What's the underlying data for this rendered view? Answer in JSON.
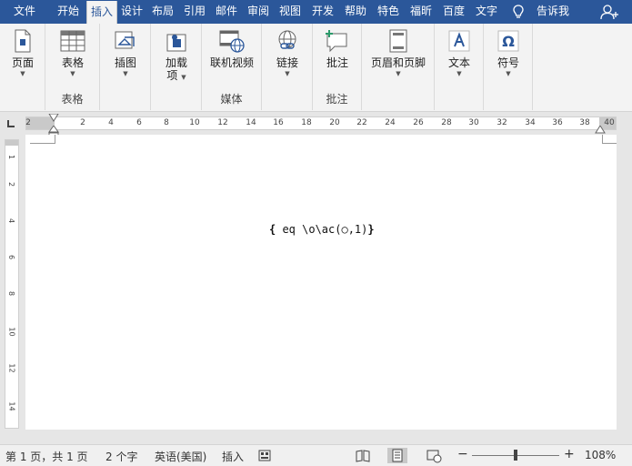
{
  "tabs": [
    {
      "label": "文件",
      "active": false
    },
    {
      "label": "开始",
      "active": false
    },
    {
      "label": "插入",
      "active": true
    },
    {
      "label": "设计",
      "active": false
    },
    {
      "label": "布局",
      "active": false
    },
    {
      "label": "引用",
      "active": false
    },
    {
      "label": "邮件",
      "active": false
    },
    {
      "label": "审阅",
      "active": false
    },
    {
      "label": "视图",
      "active": false
    },
    {
      "label": "开发",
      "active": false
    },
    {
      "label": "帮助",
      "active": false
    },
    {
      "label": "特色",
      "active": false
    },
    {
      "label": "福昕",
      "active": false
    },
    {
      "label": "百度",
      "active": false
    },
    {
      "label": "文字",
      "active": false
    }
  ],
  "tell_me": "告诉我",
  "ribbon": {
    "page": {
      "label": "页面"
    },
    "table": {
      "label": "表格",
      "group": "表格"
    },
    "illustrations": {
      "label": "插图"
    },
    "addins": {
      "label_line1": "加载",
      "label_line2": "项"
    },
    "online_video": {
      "label": "联机视频",
      "group": "媒体"
    },
    "links": {
      "label": "链接"
    },
    "comment": {
      "label": "批注",
      "group": "批注"
    },
    "header_footer": {
      "label": "页眉和页脚"
    },
    "text": {
      "label": "文本"
    },
    "symbols": {
      "label": "符号"
    }
  },
  "ruler": {
    "h_ticks": [
      "2",
      "2",
      "4",
      "6",
      "8",
      "10",
      "12",
      "14",
      "16",
      "18",
      "20",
      "22",
      "24",
      "26",
      "28",
      "30",
      "32",
      "34",
      "36",
      "38",
      "40"
    ],
    "v_ticks": [
      "1",
      "2",
      "4",
      "6",
      "8",
      "10",
      "12",
      "14"
    ]
  },
  "document": {
    "field_open": "{",
    "field_code": " eq \\o\\ac(○,1)",
    "field_close": "}"
  },
  "status": {
    "page_info": "第 1 页，共 1 页",
    "word_count": "2 个字",
    "language": "英语(美国)",
    "mode": "插入",
    "zoom_minus": "−",
    "zoom_plus": "+",
    "zoom": "108%"
  }
}
